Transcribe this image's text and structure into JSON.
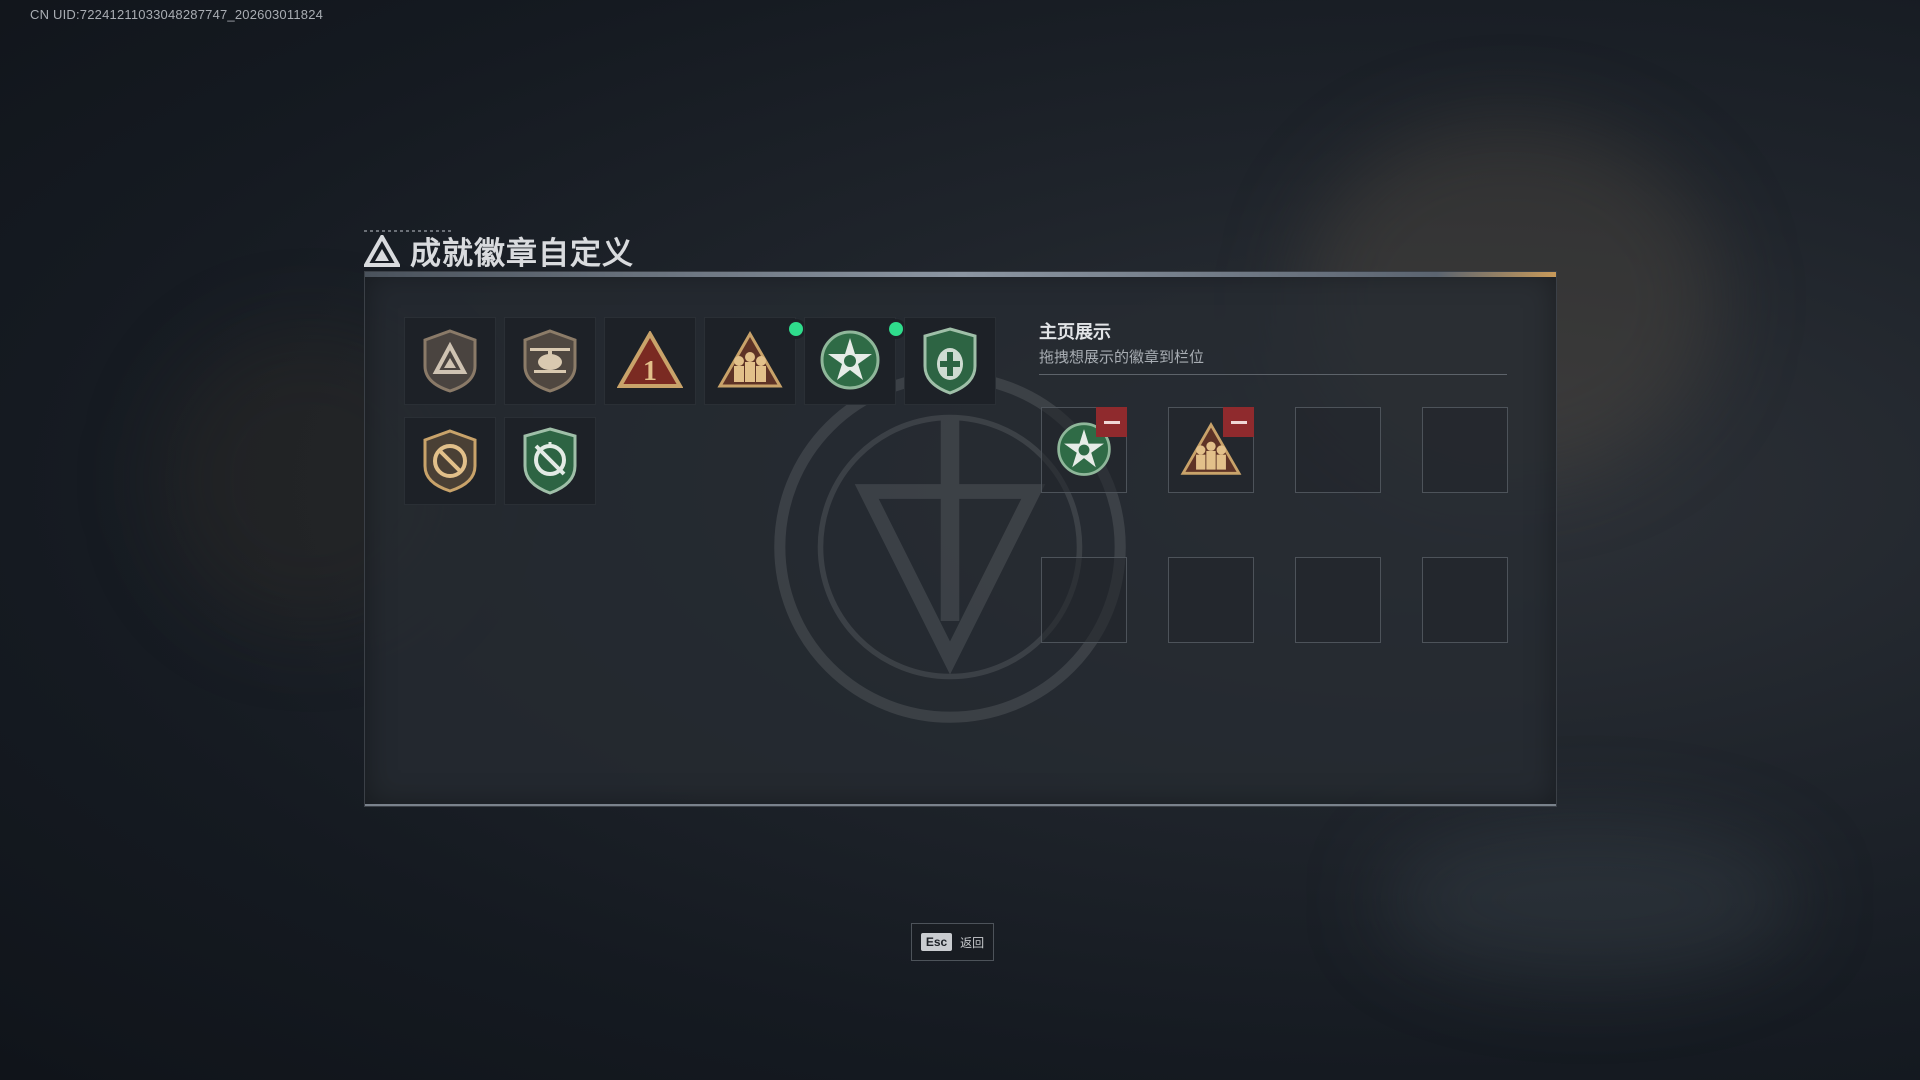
{
  "uid_text": "CN UID:7224121103304828​7747_202603011824",
  "title": "成就徽章自定义",
  "showcase": {
    "title": "主页展示",
    "subtitle": "拖拽想展示的徽章到栏位"
  },
  "badges": [
    {
      "icon": "triangle-shield-badge-icon",
      "new": false
    },
    {
      "icon": "helicopter-shield-badge-icon",
      "new": false
    },
    {
      "icon": "number-one-triangle-badge-icon",
      "label": "1",
      "new": false
    },
    {
      "icon": "soldiers-triangle-badge-icon",
      "new": true
    },
    {
      "icon": "green-star-wreath-badge-icon",
      "new": true
    },
    {
      "icon": "green-medic-shield-badge-icon",
      "new": false
    },
    {
      "icon": "no-rifle-shield-badge-icon",
      "new": false
    },
    {
      "icon": "green-crosshair-shield-badge-icon",
      "new": false
    }
  ],
  "slots": [
    {
      "badge": "green-star-wreath-badge-icon"
    },
    {
      "badge": "soldiers-triangle-badge-icon"
    },
    {
      "badge": null
    },
    {
      "badge": null
    },
    {
      "badge": null
    },
    {
      "badge": null
    },
    {
      "badge": null
    },
    {
      "badge": null
    }
  ],
  "esc": {
    "key": "Esc",
    "label": "返回"
  },
  "colors": {
    "new_dot": "#2fdc8c",
    "remove": "#8f2a2d",
    "gold": "#c9a36a",
    "green": "#2f6b46"
  }
}
